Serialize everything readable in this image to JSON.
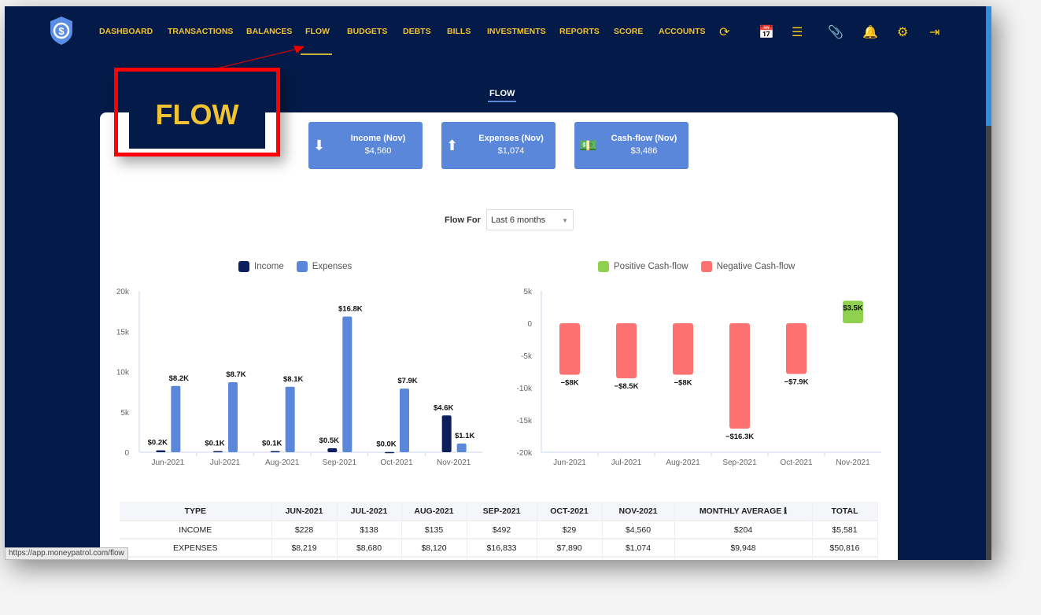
{
  "nav": {
    "items": [
      "DASHBOARD",
      "TRANSACTIONS",
      "BALANCES",
      "FLOW",
      "BUDGETS",
      "DEBTS",
      "BILLS",
      "INVESTMENTS",
      "REPORTS",
      "SCORE",
      "ACCOUNTS"
    ],
    "active": "FLOW",
    "icons": [
      "refresh-icon",
      "calendar-icon",
      "list-icon",
      "paperclip-icon",
      "bell-icon",
      "gear-icon",
      "logout-icon"
    ]
  },
  "page": {
    "title": "FLOW",
    "callout": "FLOW"
  },
  "kpis": [
    {
      "title": "Income (Nov)",
      "value": "$4,560",
      "icon": "arrow-down-circle-icon"
    },
    {
      "title": "Expenses (Nov)",
      "value": "$1,074",
      "icon": "arrow-up-circle-icon"
    },
    {
      "title": "Cash-flow (Nov)",
      "value": "$3,486",
      "icon": "money-bill-icon"
    }
  ],
  "filter": {
    "label": "Flow For",
    "value": "Last 6 months"
  },
  "colors": {
    "income": "#0a1f5c",
    "expenses": "#5a87d9",
    "positive": "#8fd14f",
    "negative": "#fd7171",
    "nav": "#f1c232"
  },
  "chart_data": [
    {
      "type": "bar",
      "categories": [
        "Jun-2021",
        "Jul-2021",
        "Aug-2021",
        "Sep-2021",
        "Oct-2021",
        "Nov-2021"
      ],
      "ylim": [
        0,
        20000
      ],
      "yticks": [
        "0",
        "5k",
        "10k",
        "15k",
        "20k"
      ],
      "legend": "top",
      "series": [
        {
          "name": "Income",
          "values": [
            228,
            138,
            135,
            492,
            29,
            4560
          ],
          "labels": [
            "$0.2K",
            "$0.1K",
            "$0.1K",
            "$0.5K",
            "$0.0K",
            "$4.6K"
          ]
        },
        {
          "name": "Expenses",
          "values": [
            8219,
            8680,
            8120,
            16833,
            7890,
            1074
          ],
          "labels": [
            "$8.2K",
            "$8.7K",
            "$8.1K",
            "$16.8K",
            "$7.9K",
            "$1.1K"
          ]
        }
      ]
    },
    {
      "type": "bar",
      "categories": [
        "Jun-2021",
        "Jul-2021",
        "Aug-2021",
        "Sep-2021",
        "Oct-2021",
        "Nov-2021"
      ],
      "ylim": [
        -20000,
        5000
      ],
      "yticks": [
        "5k",
        "0",
        "-5k",
        "-10k",
        "-15k",
        "-20k"
      ],
      "legend": "top",
      "legend_entries": [
        "Positive Cash-flow",
        "Negative Cash-flow"
      ],
      "values": [
        -7991,
        -8542,
        -7985,
        -16341,
        -7861,
        3486
      ],
      "labels": [
        "−$8K",
        "−$8.5K",
        "−$8K",
        "−$16.3K",
        "−$7.9K",
        "$3.5K"
      ]
    }
  ],
  "table": {
    "headers": [
      "TYPE",
      "JUN-2021",
      "JUL-2021",
      "AUG-2021",
      "SEP-2021",
      "OCT-2021",
      "NOV-2021",
      "MONTHLY AVERAGE",
      "TOTAL"
    ],
    "rows": [
      [
        "INCOME",
        "$228",
        "$138",
        "$135",
        "$492",
        "$29",
        "$4,560",
        "$204",
        "$5,581"
      ],
      [
        "EXPENSES",
        "$8,219",
        "$8,680",
        "$8,120",
        "$16,833",
        "$7,890",
        "$1,074",
        "$9,948",
        "$50,816"
      ]
    ]
  },
  "status_url": "https://app.moneypatrol.com/flow"
}
